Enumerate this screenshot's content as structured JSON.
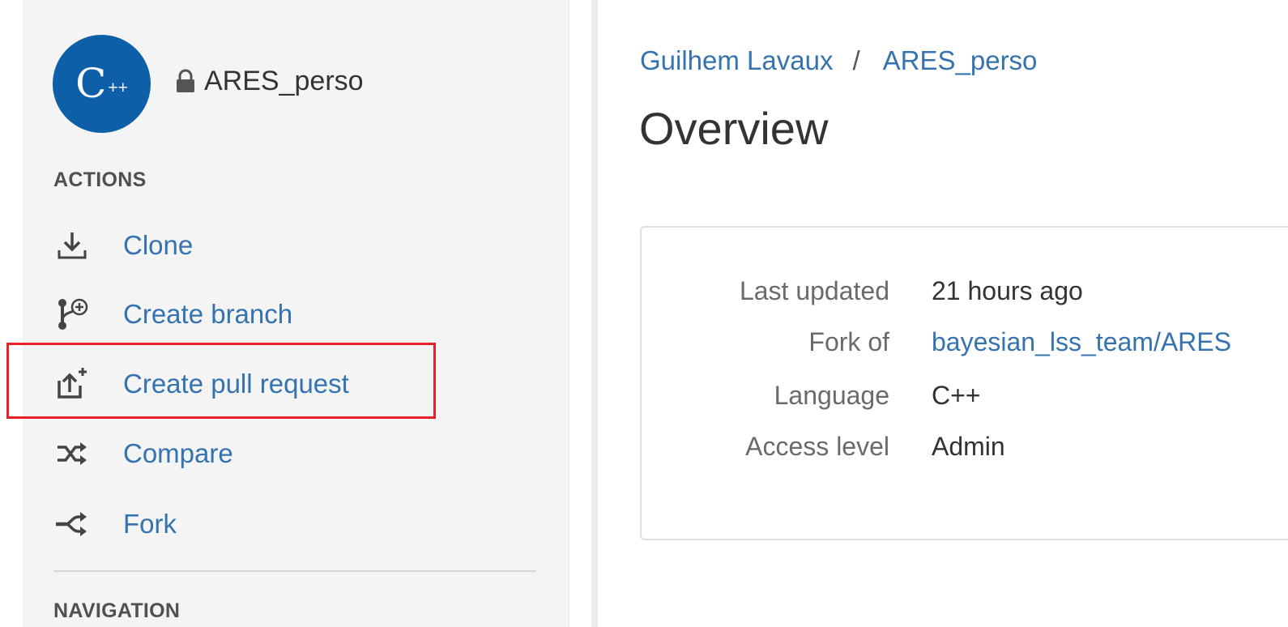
{
  "repo": {
    "avatar_letter": "C",
    "avatar_suffix": "++",
    "name": "ARES_perso",
    "avatar_color": "#0d5fa8"
  },
  "sidebar": {
    "actions_heading": "ACTIONS",
    "actions": [
      {
        "label": "Clone",
        "icon": "clone-icon"
      },
      {
        "label": "Create branch",
        "icon": "create-branch-icon"
      },
      {
        "label": "Create pull request",
        "icon": "create-pull-request-icon"
      },
      {
        "label": "Compare",
        "icon": "compare-icon"
      },
      {
        "label": "Fork",
        "icon": "fork-icon"
      }
    ],
    "navigation_heading": "NAVIGATION"
  },
  "breadcrumb": {
    "owner": "Guilhem Lavaux",
    "separator": "/",
    "repo": "ARES_perso"
  },
  "main": {
    "title": "Overview",
    "info": [
      {
        "label": "Last updated",
        "value": "21 hours ago"
      },
      {
        "label": "Fork of",
        "value": "bayesian_lss_team/ARES"
      },
      {
        "label": "Language",
        "value": "C++"
      },
      {
        "label": "Access level",
        "value": "Admin"
      }
    ]
  },
  "colors": {
    "link": "#3572b0",
    "highlight": "#e8202a",
    "sidebar_bg": "#f4f4f4"
  }
}
